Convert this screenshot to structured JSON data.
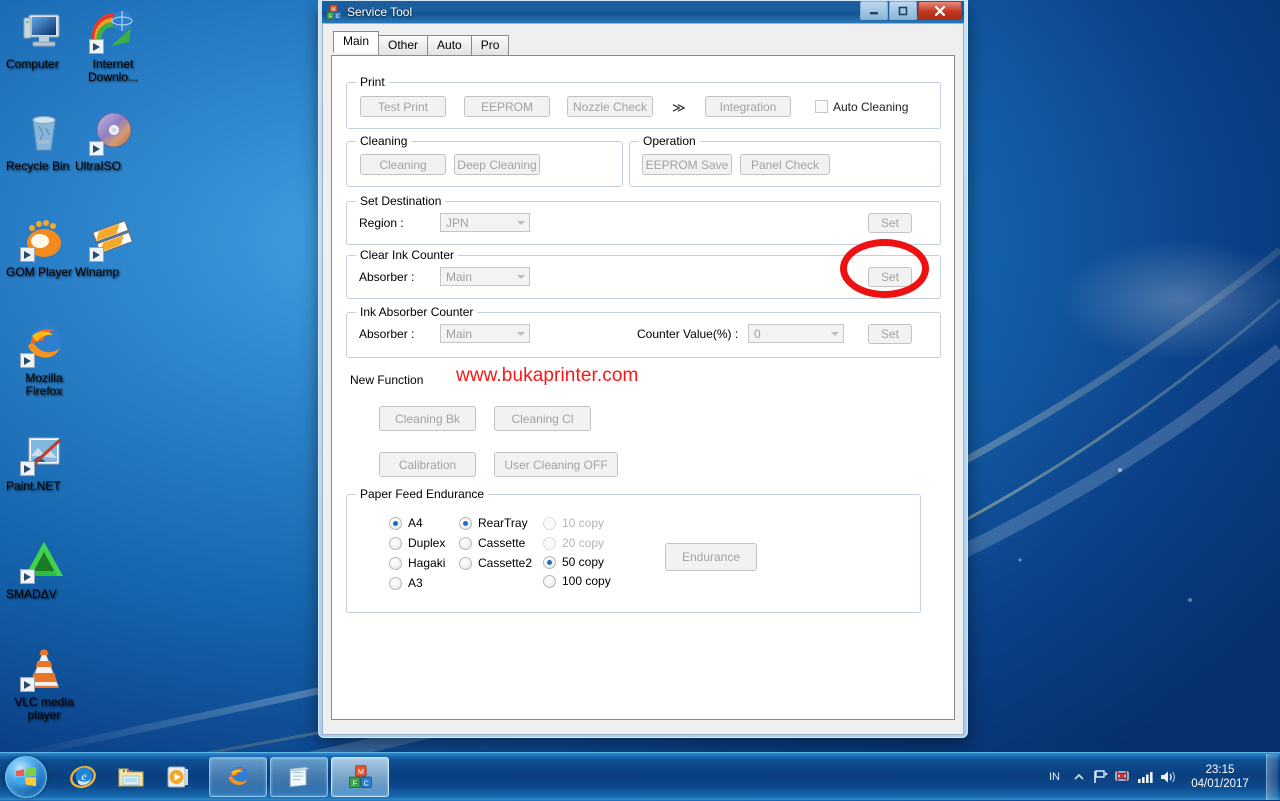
{
  "desktop": {
    "icons": [
      {
        "label": "Computer",
        "icon": "computer-icon",
        "shortcut": false
      },
      {
        "label": "Internet Downlo...",
        "icon": "internet-download-manager-icon",
        "shortcut": true
      },
      {
        "label": "Recycle Bin",
        "icon": "recycle-bin-icon",
        "shortcut": false
      },
      {
        "label": "UltraISO",
        "icon": "ultraiso-icon",
        "shortcut": true
      },
      {
        "label": "GOM Player",
        "icon": "gom-player-icon",
        "shortcut": true
      },
      {
        "label": "Winamp",
        "icon": "winamp-icon",
        "shortcut": true
      },
      {
        "label": "Mozilla Firefox",
        "icon": "firefox-icon",
        "shortcut": true
      },
      {
        "label": "Paint.NET",
        "icon": "paint-net-icon",
        "shortcut": true
      },
      {
        "label": "SMADΔV",
        "icon": "smadav-icon",
        "shortcut": true
      },
      {
        "label": "VLC media player",
        "icon": "vlc-icon",
        "shortcut": true
      }
    ]
  },
  "taskbar": {
    "start_label": "Start",
    "quick_launch": [
      {
        "name": "internet-explorer-icon"
      },
      {
        "name": "windows-explorer-icon"
      },
      {
        "name": "windows-media-player-icon"
      }
    ],
    "windows": [
      {
        "name": "firefox-window",
        "icon": "firefox-icon",
        "active": false
      },
      {
        "name": "notepad-window",
        "icon": "notepad-icon",
        "active": false
      },
      {
        "name": "service-tool-window",
        "icon": "blocks-icon",
        "active": true
      }
    ],
    "tray": {
      "language": "IN",
      "icons": [
        "show-hidden-icons-chevron",
        "flag-action-center-icon",
        "network-error-icon",
        "signal-bars-icon",
        "volume-icon"
      ],
      "time": "23:15",
      "date": "04/01/2017"
    }
  },
  "window": {
    "title": "Service Tool",
    "icon": "service-tool-blocks-icon",
    "controls": {
      "minimize": "─",
      "maximize": "▭",
      "close": "✕"
    },
    "tabs": [
      {
        "label": "Main",
        "active": true
      },
      {
        "label": "Other",
        "active": false
      },
      {
        "label": "Auto",
        "active": false
      },
      {
        "label": "Pro",
        "active": false
      }
    ],
    "groups": {
      "print": {
        "title": "Print",
        "buttons": [
          "Test Print",
          "EEPROM",
          "Nozzle Check",
          "Integration"
        ],
        "chevron": "≫",
        "checkbox": {
          "label": "Auto Cleaning",
          "checked": false
        }
      },
      "cleaning": {
        "title": "Cleaning",
        "buttons": [
          "Cleaning",
          "Deep Cleaning"
        ]
      },
      "operation": {
        "title": "Operation",
        "buttons": [
          "EEPROM Save",
          "Panel Check"
        ]
      },
      "set_destination": {
        "title": "Set Destination",
        "field_label": "Region :",
        "value": "JPN",
        "set_label": "Set"
      },
      "clear_ink_counter": {
        "title": "Clear Ink Counter",
        "field_label": "Absorber :",
        "value": "Main",
        "set_label": "Set"
      },
      "ink_absorber_counter": {
        "title": "Ink Absorber Counter",
        "field_label": "Absorber :",
        "value": "Main",
        "counter_label": "Counter Value(%) :",
        "counter_value": "0",
        "set_label": "Set"
      },
      "new_function": {
        "title": "New Function",
        "watermark": "www.bukaprinter.com",
        "watermark_color": "#fb1616",
        "buttons": [
          "Cleaning Bk",
          "Cleaning Cl",
          "Calibration",
          "User Cleaning OFF"
        ]
      },
      "paper_feed_endurance": {
        "title": "Paper Feed Endurance",
        "paper_sizes": [
          {
            "label": "A4",
            "selected": true,
            "disabled": false
          },
          {
            "label": "Duplex",
            "selected": false,
            "disabled": false
          },
          {
            "label": "Hagaki",
            "selected": false,
            "disabled": false
          },
          {
            "label": "A3",
            "selected": false,
            "disabled": false
          }
        ],
        "trays": [
          {
            "label": "RearTray",
            "selected": true,
            "disabled": false
          },
          {
            "label": "Cassette",
            "selected": false,
            "disabled": false
          },
          {
            "label": "Cassette2",
            "selected": false,
            "disabled": false
          }
        ],
        "copies": [
          {
            "label": "10 copy",
            "selected": false,
            "disabled": true
          },
          {
            "label": "20 copy",
            "selected": false,
            "disabled": true
          },
          {
            "label": "50 copy",
            "selected": true,
            "disabled": false
          },
          {
            "label": "100 copy",
            "selected": false,
            "disabled": false
          }
        ],
        "action_button": "Endurance"
      }
    }
  },
  "annotation": {
    "name": "red-circle-highlight",
    "color": "#ee1111",
    "targets": "clear-ink-counter-set-button"
  }
}
